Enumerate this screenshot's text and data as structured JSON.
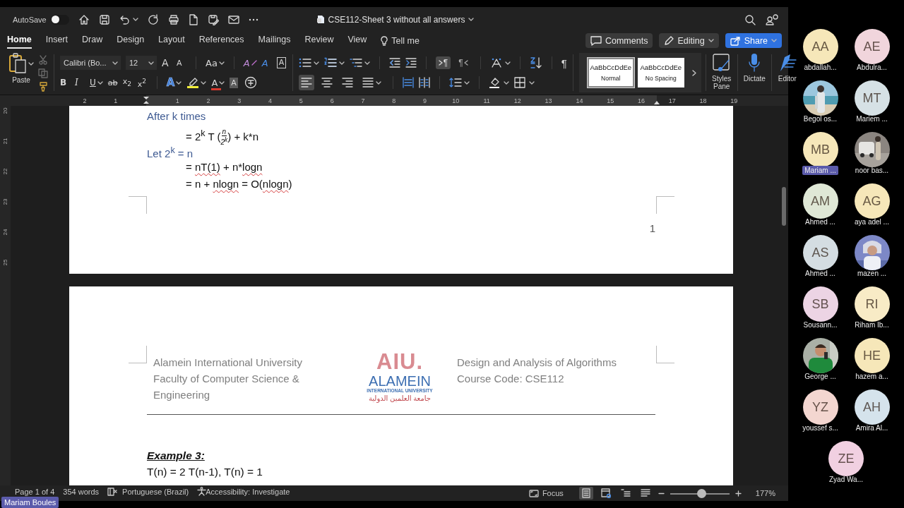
{
  "title_bar": {
    "autosave_label": "AutoSave",
    "autosave_on": false,
    "document_title": "CSE112-Sheet 3 without all answers"
  },
  "ribbon_tabs": [
    {
      "label": "Home",
      "selected": true
    },
    {
      "label": "Insert",
      "selected": false
    },
    {
      "label": "Draw",
      "selected": false
    },
    {
      "label": "Design",
      "selected": false
    },
    {
      "label": "Layout",
      "selected": false
    },
    {
      "label": "References",
      "selected": false
    },
    {
      "label": "Mailings",
      "selected": false
    },
    {
      "label": "Review",
      "selected": false
    },
    {
      "label": "View",
      "selected": false
    }
  ],
  "tell_me": "Tell me",
  "action_buttons": [
    {
      "kind": "comments",
      "label": "Comments"
    },
    {
      "kind": "editing",
      "label": "Editing"
    },
    {
      "kind": "share",
      "label": "Share"
    }
  ],
  "ribbon": {
    "paste_label": "Paste",
    "font_name": "Calibri (Bo...",
    "font_size": "12",
    "font_tools": [
      {
        "kind": "grow",
        "glyph": "A"
      },
      {
        "kind": "shrink",
        "glyph": "A"
      },
      {
        "kind": "case",
        "glyph": "Aa"
      },
      {
        "kind": "clear",
        "glyph": "A"
      },
      {
        "kind": "effects",
        "glyph": "A"
      },
      {
        "kind": "border",
        "glyph": "A"
      }
    ],
    "format_tools": [
      {
        "kind": "bold",
        "glyph": "B"
      },
      {
        "kind": "italic",
        "glyph": "I"
      },
      {
        "kind": "underline",
        "glyph": "U"
      },
      {
        "kind": "strike",
        "glyph": "ab"
      },
      {
        "kind": "subscript",
        "glyph": "x$_{2}$"
      },
      {
        "kind": "superscript",
        "glyph": "x$^{2}$"
      },
      {
        "kind": "text_effects",
        "glyph": "A"
      },
      {
        "kind": "highlight"
      },
      {
        "kind": "font_color",
        "glyph": "A"
      },
      {
        "kind": "shading",
        "glyph": "A"
      },
      {
        "kind": "phonetic"
      }
    ],
    "direction_buttons": [
      {
        "kind": "ltr",
        "glyph": "¶",
        "selected": true
      },
      {
        "kind": "rtl",
        "glyph": "¶",
        "selected": false
      }
    ],
    "pilcrow": "¶",
    "alignment_buttons": [
      {
        "kind": "left",
        "selected": true
      },
      {
        "kind": "center",
        "selected": false
      },
      {
        "kind": "right",
        "selected": false
      },
      {
        "kind": "justify",
        "selected": false
      }
    ],
    "styles": [
      {
        "sample": "AaBbCcDdEe",
        "name": "Normal",
        "selected": true
      },
      {
        "sample": "AaBbCcDdEe",
        "name": "No Spacing",
        "selected": false
      }
    ],
    "tools": [
      {
        "kind": "styles_pane",
        "label": "Styles Pane"
      },
      {
        "kind": "dictate",
        "label": "Dictate"
      },
      {
        "kind": "editor",
        "label": "Editor"
      }
    ]
  },
  "ruler": {
    "left_marks": [
      "2",
      "1"
    ],
    "marks": [
      "1",
      "2",
      "3",
      "4",
      "5",
      "6",
      "7",
      "8",
      "9",
      "10",
      "11",
      "12",
      "13",
      "14",
      "15",
      "16",
      "17",
      "18",
      "19"
    ],
    "vertical_marks": [
      "20",
      "21",
      "22",
      "23",
      "24",
      "25"
    ]
  },
  "page_1": {
    "lines": [
      {
        "kind": "heading",
        "text": "After k times"
      },
      {
        "kind": "fraction",
        "before": "= 2$^{k}$ T (",
        "numerator": "n",
        "denominator": "2$^{k}$",
        "after": ") + k*n"
      },
      {
        "kind": "heading",
        "text": "Let 2$^{k}$ = n"
      },
      {
        "kind": "equation",
        "parts": [
          {
            "text": "= "
          },
          {
            "text": "nT(1)",
            "misspelled": true
          },
          {
            "text": " + n*"
          },
          {
            "text": "logn",
            "misspelled": true
          }
        ]
      },
      {
        "kind": "equation",
        "parts": [
          {
            "text": "= n + "
          },
          {
            "text": "nlogn",
            "misspelled": true
          },
          {
            "text": " = O("
          },
          {
            "text": "nlogn",
            "misspelled": true
          },
          {
            "text": ")"
          }
        ]
      }
    ],
    "page_number": "1"
  },
  "page_2": {
    "header": {
      "left": [
        "Alamein International University",
        "Faculty of Computer Science & Engineering"
      ],
      "logo": {
        "mark": "AIU.",
        "name": "ALAMEIN",
        "subtitle": "INTERNATIONAL UNIVERSITY",
        "arabic": "جامعة العلمين الدولية"
      },
      "right": [
        "Design and Analysis of Algorithms",
        "Course Code: CSE112"
      ]
    },
    "lines": [
      {
        "kind": "example_heading",
        "text": "Example 3:"
      },
      {
        "kind": "line",
        "text": "T(n) = 2 T(n-1), T(n) = 1"
      }
    ]
  },
  "status_bar": {
    "items": [
      {
        "kind": "page",
        "text": "Page 1 of 4"
      },
      {
        "kind": "words",
        "text": "354 words"
      },
      {
        "kind": "proofing",
        "text": "Portuguese (Brazil)"
      },
      {
        "kind": "accessibility",
        "text": "Accessibility: Investigate"
      }
    ],
    "focus": "Focus",
    "views": [
      {
        "kind": "print",
        "selected": true
      },
      {
        "kind": "web",
        "selected": false
      },
      {
        "kind": "outline",
        "selected": false
      },
      {
        "kind": "draft",
        "selected": false
      }
    ],
    "zoom": {
      "level": 0.53,
      "text": "177%"
    }
  },
  "participants": [
    {
      "kind": "initials",
      "initials": "AA",
      "name": "abdallah...",
      "color": "#f6e7b9",
      "highlighted": false
    },
    {
      "kind": "initials",
      "initials": "AE",
      "name": "Abdulra...",
      "color": "#f1d5dc",
      "highlighted": false
    },
    {
      "kind": "picture",
      "name": "Begol os...",
      "highlighted": false
    },
    {
      "kind": "initials",
      "initials": "MT",
      "name": "Mariem ...",
      "color": "#d6e1e5",
      "highlighted": false
    },
    {
      "kind": "initials",
      "initials": "MB",
      "name": "Mariam ...",
      "color": "#f6e7b9",
      "highlighted": true
    },
    {
      "kind": "picture",
      "name": "noor bas...",
      "highlighted": false
    },
    {
      "kind": "initials",
      "initials": "AM",
      "name": "Ahmed ...",
      "color": "#dfe8d6",
      "highlighted": false
    },
    {
      "kind": "initials",
      "initials": "AG",
      "name": "aya adel ...",
      "color": "#f6e7b9",
      "highlighted": false
    },
    {
      "kind": "initials",
      "initials": "AS",
      "name": "Ahmed ...",
      "color": "#d4dde2",
      "highlighted": false
    },
    {
      "kind": "picture",
      "name": "mazen ...",
      "highlighted": false
    },
    {
      "kind": "initials",
      "initials": "SB",
      "name": "Sousann...",
      "color": "#ecd4e4",
      "highlighted": false
    },
    {
      "kind": "initials",
      "initials": "RI",
      "name": "Riham Ib...",
      "color": "#f8ebc6",
      "highlighted": false
    },
    {
      "kind": "picture",
      "name": "George ...",
      "highlighted": false
    },
    {
      "kind": "initials",
      "initials": "HE",
      "name": "hazem a...",
      "color": "#f6e7b9",
      "highlighted": false
    },
    {
      "kind": "initials",
      "initials": "YZ",
      "name": "youssef s...",
      "color": "#f3d6d0",
      "highlighted": false
    },
    {
      "kind": "initials",
      "initials": "AH",
      "name": "Amira Al...",
      "color": "#d5e3ec",
      "highlighted": false
    },
    {
      "kind": "initials",
      "initials": "ZE",
      "name": "Zyad Wa...",
      "color": "#f1d0e1",
      "highlighted": false
    }
  ],
  "presenter_label": "Mariam Boules"
}
